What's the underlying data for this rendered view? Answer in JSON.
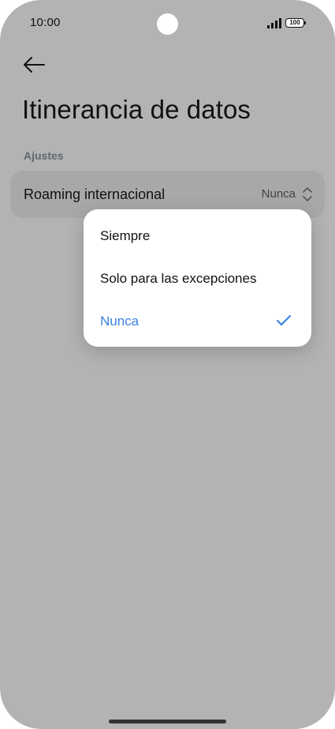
{
  "status_bar": {
    "time": "10:00",
    "battery": "100"
  },
  "header": {
    "title": "Itinerancia de datos"
  },
  "section": {
    "label": "Ajustes"
  },
  "setting": {
    "label": "Roaming internacional",
    "value": "Nunca"
  },
  "dropdown": {
    "options": [
      {
        "label": "Siempre",
        "selected": false
      },
      {
        "label": "Solo para las excepciones",
        "selected": false
      },
      {
        "label": "Nunca",
        "selected": true
      }
    ]
  },
  "colors": {
    "accent": "#3b82e3",
    "dim_background": "#b3b3b3"
  },
  "icons": {
    "back": "arrow-left-icon",
    "chevrons": "up-down-chevron-icon",
    "check": "checkmark-icon"
  }
}
